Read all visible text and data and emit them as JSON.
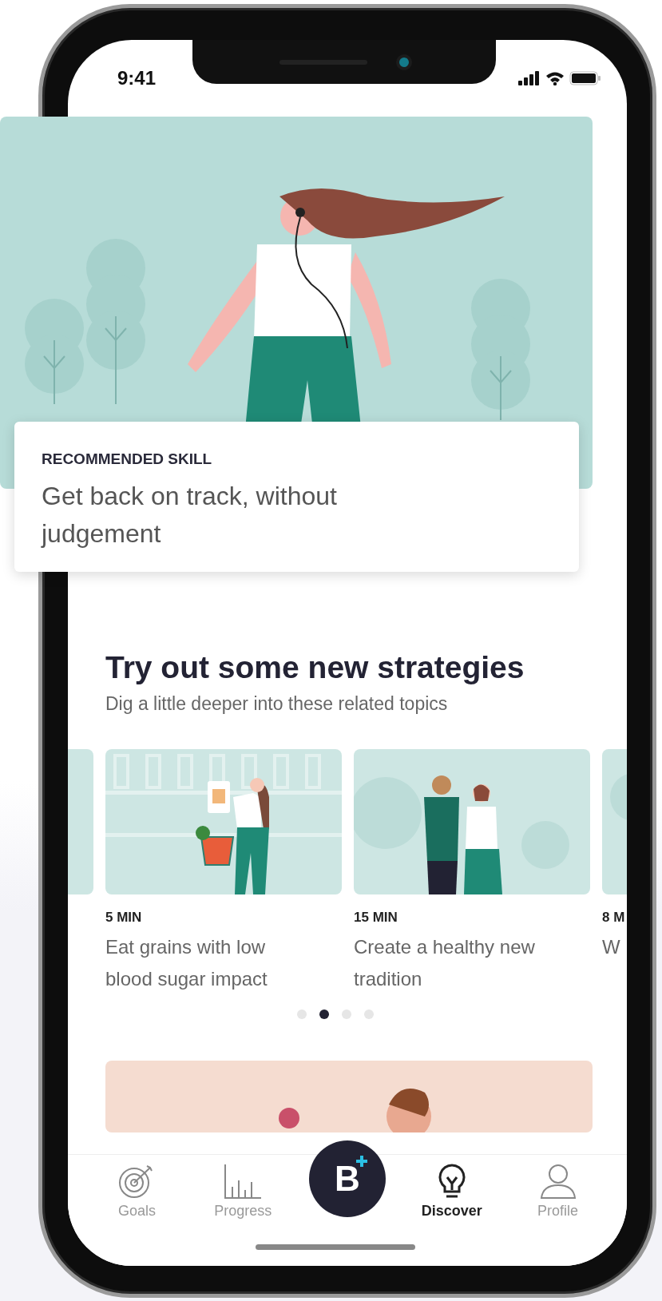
{
  "status_bar": {
    "time": "9:41"
  },
  "recommended": {
    "label": "RECOMMENDED SKILL",
    "title": "Get back on track, without judgement"
  },
  "section": {
    "title": "Try out some new strategies",
    "subtitle": "Dig a little deeper into these related topics"
  },
  "topics": [
    {
      "kind": "partial"
    },
    {
      "kind": "shopping",
      "duration": "5 MIN",
      "title": "Eat grains with low blood sugar impact"
    },
    {
      "kind": "couple",
      "duration": "15 MIN",
      "title": "Create a healthy new tradition"
    },
    {
      "kind": "partial",
      "duration": "8 M",
      "title": "W"
    }
  ],
  "pager": [
    {
      "selected": false
    },
    {
      "selected": true
    },
    {
      "selected": false
    },
    {
      "selected": false
    }
  ],
  "nav": [
    {
      "kind": "goals",
      "label": "Goals",
      "selected": false
    },
    {
      "kind": "progress",
      "label": "Progress",
      "selected": false
    },
    {
      "kind": "action",
      "label": "B"
    },
    {
      "kind": "discover",
      "label": "Discover",
      "selected": true
    },
    {
      "kind": "profile",
      "label": "Profile",
      "selected": false
    }
  ]
}
